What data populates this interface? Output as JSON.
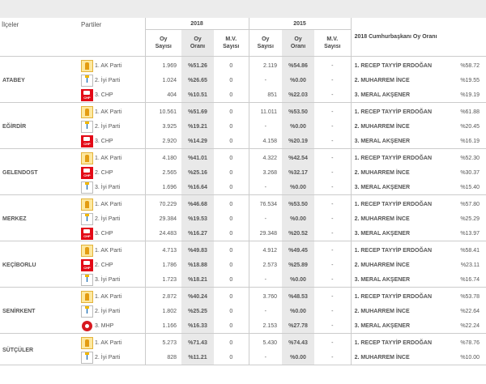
{
  "header": {
    "district_col": "İlçeler",
    "parties_col": "Partiler",
    "year_2018": "2018",
    "year_2015": "2015",
    "oy_sayisi": [
      "Oy",
      "Sayısı"
    ],
    "oy_orani": [
      "Oy",
      "Oranı"
    ],
    "mv_sayisi": [
      "M.V.",
      "Sayısı"
    ],
    "cb_title": "2018 Cumhurbaşkanı Oy Oranı"
  },
  "districts": [
    {
      "name": "ATABEY",
      "rows": [
        {
          "logo": "akp-logo-icon",
          "party": "1. AK Parti",
          "v18": "1.969",
          "p18": "%51.26",
          "mv18": "0",
          "v15": "2.119",
          "p15": "%54.86",
          "mv15": "-",
          "cand": "1. RECEP TAYYİP ERDOĞAN",
          "cbp": "%58.72"
        },
        {
          "logo": "iyi-logo-icon",
          "party": "2. İyi Parti",
          "v18": "1.024",
          "p18": "%26.65",
          "mv18": "0",
          "v15": "-",
          "p15": "%0.00",
          "mv15": "-",
          "cand": "2. MUHARREM İNCE",
          "cbp": "%19.55"
        },
        {
          "logo": "chp-logo-icon",
          "party": "3. CHP",
          "v18": "404",
          "p18": "%10.51",
          "mv18": "0",
          "v15": "851",
          "p15": "%22.03",
          "mv15": "-",
          "cand": "3. MERAL AKŞENER",
          "cbp": "%19.19"
        }
      ]
    },
    {
      "name": "EĞİRDİR",
      "rows": [
        {
          "logo": "akp-logo-icon",
          "party": "1. AK Parti",
          "v18": "10.561",
          "p18": "%51.69",
          "mv18": "0",
          "v15": "11.011",
          "p15": "%53.50",
          "mv15": "-",
          "cand": "1. RECEP TAYYİP ERDOĞAN",
          "cbp": "%61.88"
        },
        {
          "logo": "iyi-logo-icon",
          "party": "2. İyi Parti",
          "v18": "3.925",
          "p18": "%19.21",
          "mv18": "0",
          "v15": "-",
          "p15": "%0.00",
          "mv15": "-",
          "cand": "2. MUHARREM İNCE",
          "cbp": "%20.45"
        },
        {
          "logo": "chp-logo-icon",
          "party": "3. CHP",
          "v18": "2.920",
          "p18": "%14.29",
          "mv18": "0",
          "v15": "4.158",
          "p15": "%20.19",
          "mv15": "-",
          "cand": "3. MERAL AKŞENER",
          "cbp": "%16.19"
        }
      ]
    },
    {
      "name": "GELENDOST",
      "rows": [
        {
          "logo": "akp-logo-icon",
          "party": "1. AK Parti",
          "v18": "4.180",
          "p18": "%41.01",
          "mv18": "0",
          "v15": "4.322",
          "p15": "%42.54",
          "mv15": "-",
          "cand": "1. RECEP TAYYİP ERDOĞAN",
          "cbp": "%52.30"
        },
        {
          "logo": "chp-logo-icon",
          "party": "2. CHP",
          "v18": "2.565",
          "p18": "%25.16",
          "mv18": "0",
          "v15": "3.268",
          "p15": "%32.17",
          "mv15": "-",
          "cand": "2. MUHARREM İNCE",
          "cbp": "%30.37"
        },
        {
          "logo": "iyi-logo-icon",
          "party": "3. İyi Parti",
          "v18": "1.696",
          "p18": "%16.64",
          "mv18": "0",
          "v15": "-",
          "p15": "%0.00",
          "mv15": "-",
          "cand": "3. MERAL AKŞENER",
          "cbp": "%15.40"
        }
      ]
    },
    {
      "name": "MERKEZ",
      "rows": [
        {
          "logo": "akp-logo-icon",
          "party": "1. AK Parti",
          "v18": "70.229",
          "p18": "%46.68",
          "mv18": "0",
          "v15": "76.534",
          "p15": "%53.50",
          "mv15": "-",
          "cand": "1. RECEP TAYYİP ERDOĞAN",
          "cbp": "%57.80"
        },
        {
          "logo": "iyi-logo-icon",
          "party": "2. İyi Parti",
          "v18": "29.384",
          "p18": "%19.53",
          "mv18": "0",
          "v15": "-",
          "p15": "%0.00",
          "mv15": "-",
          "cand": "2. MUHARREM İNCE",
          "cbp": "%25.29"
        },
        {
          "logo": "chp-logo-icon",
          "party": "3. CHP",
          "v18": "24.483",
          "p18": "%16.27",
          "mv18": "0",
          "v15": "29.348",
          "p15": "%20.52",
          "mv15": "-",
          "cand": "3. MERAL AKŞENER",
          "cbp": "%13.97"
        }
      ]
    },
    {
      "name": "KEÇİBORLU",
      "rows": [
        {
          "logo": "akp-logo-icon",
          "party": "1. AK Parti",
          "v18": "4.713",
          "p18": "%49.83",
          "mv18": "0",
          "v15": "4.912",
          "p15": "%49.45",
          "mv15": "-",
          "cand": "1. RECEP TAYYİP ERDOĞAN",
          "cbp": "%58.41"
        },
        {
          "logo": "chp-logo-icon",
          "party": "2. CHP",
          "v18": "1.786",
          "p18": "%18.88",
          "mv18": "0",
          "v15": "2.573",
          "p15": "%25.89",
          "mv15": "-",
          "cand": "2. MUHARREM İNCE",
          "cbp": "%23.11"
        },
        {
          "logo": "iyi-logo-icon",
          "party": "3. İyi Parti",
          "v18": "1.723",
          "p18": "%18.21",
          "mv18": "0",
          "v15": "-",
          "p15": "%0.00",
          "mv15": "-",
          "cand": "3. MERAL AKŞENER",
          "cbp": "%16.74"
        }
      ]
    },
    {
      "name": "SENİRKENT",
      "rows": [
        {
          "logo": "akp-logo-icon",
          "party": "1. AK Parti",
          "v18": "2.872",
          "p18": "%40.24",
          "mv18": "0",
          "v15": "3.760",
          "p15": "%48.53",
          "mv15": "-",
          "cand": "1. RECEP TAYYİP ERDOĞAN",
          "cbp": "%53.78"
        },
        {
          "logo": "iyi-logo-icon",
          "party": "2. İyi Parti",
          "v18": "1.802",
          "p18": "%25.25",
          "mv18": "0",
          "v15": "-",
          "p15": "%0.00",
          "mv15": "-",
          "cand": "2. MUHARREM İNCE",
          "cbp": "%22.64"
        },
        {
          "logo": "mhp-logo-icon",
          "party": "3. MHP",
          "v18": "1.166",
          "p18": "%16.33",
          "mv18": "0",
          "v15": "2.153",
          "p15": "%27.78",
          "mv15": "-",
          "cand": "3. MERAL AKŞENER",
          "cbp": "%22.24"
        }
      ]
    },
    {
      "name": "SÜTÇÜLER",
      "rows": [
        {
          "logo": "akp-logo-icon",
          "party": "1. AK Parti",
          "v18": "5.273",
          "p18": "%71.43",
          "mv18": "0",
          "v15": "5.430",
          "p15": "%74.43",
          "mv15": "-",
          "cand": "1. RECEP TAYYİP ERDOĞAN",
          "cbp": "%78.76"
        },
        {
          "logo": "iyi-logo-icon",
          "party": "2. İyi Parti",
          "v18": "828",
          "p18": "%11.21",
          "mv18": "0",
          "v15": "-",
          "p15": "%0.00",
          "mv15": "-",
          "cand": "2. MUHARREM İNCE",
          "cbp": "%10.00"
        }
      ]
    }
  ]
}
